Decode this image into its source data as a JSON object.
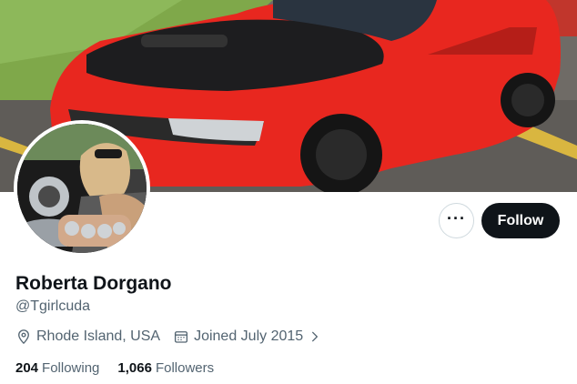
{
  "profile": {
    "name": "Roberta Dorgano",
    "handle": "@Tgirlcuda",
    "location": "Rhode Island, USA",
    "joined": "Joined July 2015"
  },
  "stats": {
    "following_count": "204",
    "following_label": "Following",
    "followers_count": "1,066",
    "followers_label": "Followers"
  },
  "actions": {
    "more_label": "···",
    "follow_label": "Follow"
  },
  "icons": {
    "more": "more-icon",
    "location": "location-pin-icon",
    "calendar": "calendar-icon",
    "chevron": "chevron-right-icon"
  },
  "colors": {
    "accent_dark": "#0f1419",
    "secondary_text": "#536471",
    "border": "#cfd9de",
    "banner_car": "#e8271f"
  }
}
